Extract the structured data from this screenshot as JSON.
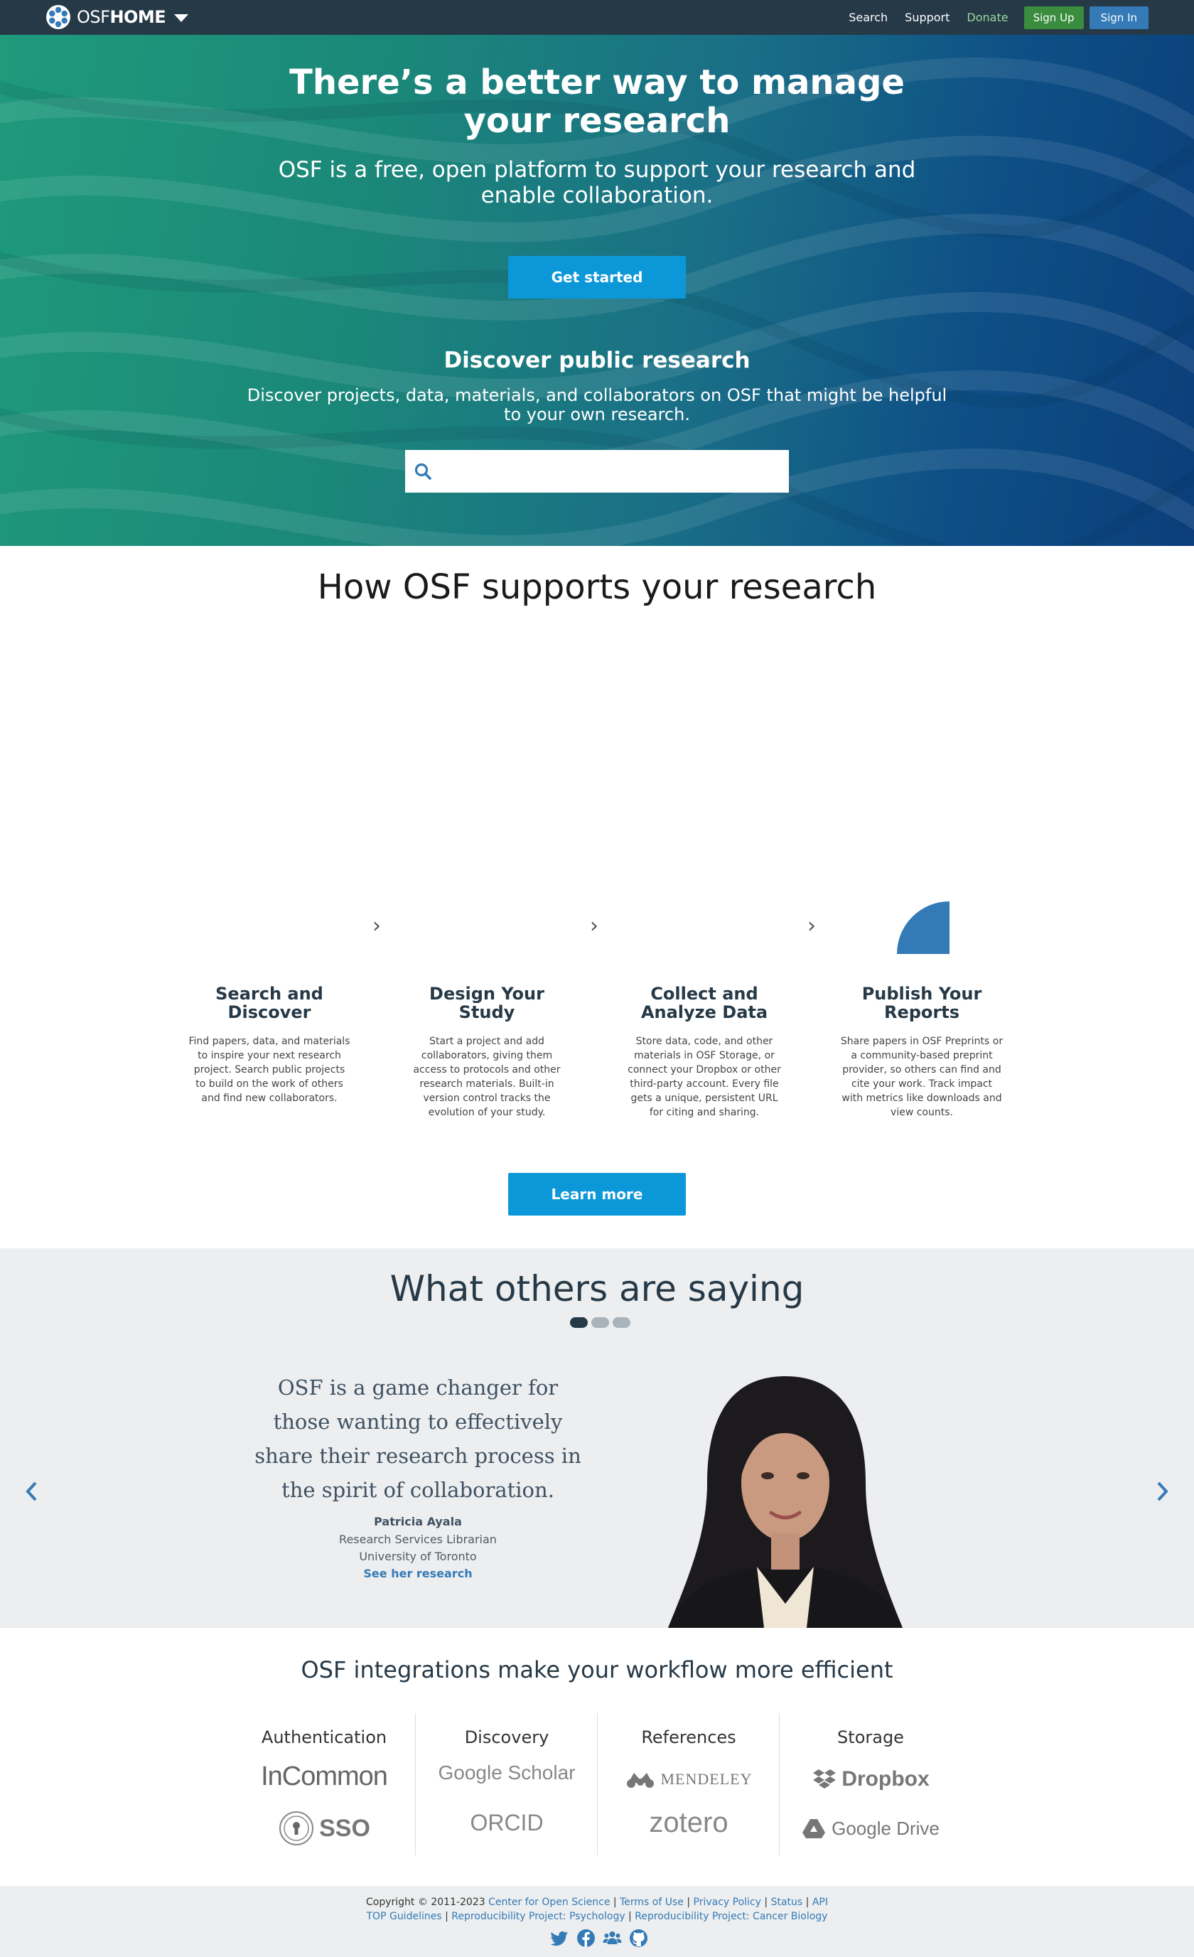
{
  "nav": {
    "brand_prefix": "OSF",
    "brand_suffix": "HOME",
    "links": [
      "Search",
      "Support",
      "Donate"
    ],
    "signup": "Sign Up",
    "signin": "Sign In"
  },
  "hero": {
    "title": "There’s a better way to manage your research",
    "subtitle": "OSF is a free, open platform to support your research and enable collaboration.",
    "cta": "Get started",
    "discover_title": "Discover public research",
    "discover_subtitle": "Discover projects, data, materials, and collaborators on OSF that might be helpful to your own research.",
    "search_placeholder": ""
  },
  "how": {
    "title": "How OSF supports your research",
    "steps": [
      {
        "title": "Search and Discover",
        "desc": "Find papers, data, and materials to inspire your next research project. Search public projects to build on the work of others and find new collaborators."
      },
      {
        "title": "Design Your Study",
        "desc": "Start a project and add collaborators, giving them access to protocols and other research materials. Built-in version control tracks the evolution of your study."
      },
      {
        "title": "Collect and Analyze Data",
        "desc": "Store data, code, and other materials in OSF Storage, or connect your Dropbox or other third-party account. Every file gets a unique, persistent URL for citing and sharing."
      },
      {
        "title": "Publish Your Reports",
        "desc": "Share papers in OSF Preprints or a community-based preprint provider, so others can find and cite your work. Track impact with metrics like downloads and view counts."
      }
    ],
    "cta": "Learn more"
  },
  "testimonials": {
    "title": "What others are saying",
    "quote": "OSF is a game changer for those wanting to effectively share their research process in the spirit of collaboration.",
    "name": "Patricia Ayala",
    "role": "Research Services Librarian",
    "org": "University of Toronto",
    "link": "See her research"
  },
  "integrations": {
    "title": "OSF integrations make your workflow more efficient",
    "columns": [
      {
        "title": "Authentication",
        "logos": [
          "InCommon",
          "SSO"
        ]
      },
      {
        "title": "Discovery",
        "logos": [
          "Google Scholar",
          "ORCID"
        ]
      },
      {
        "title": "References",
        "logos": [
          "MENDELEY",
          "zotero"
        ]
      },
      {
        "title": "Storage",
        "logos": [
          "Dropbox",
          "Google Drive"
        ]
      }
    ]
  },
  "footer": {
    "copyright": "Copyright © 2011-2023",
    "links1": [
      "Center for Open Science",
      "Terms of Use",
      "Privacy Policy",
      "Status",
      "API"
    ],
    "links2": [
      "TOP Guidelines",
      "Reproducibility Project: Psychology",
      "Reproducibility Project: Cancer Biology"
    ],
    "social_icons": [
      "twitter-icon",
      "facebook-icon",
      "group-icon",
      "github-icon"
    ]
  },
  "colors": {
    "navbar": "#263947",
    "primary_button": "#0c98d8",
    "signup": "#3a8c3e",
    "signin": "#337ab7",
    "hero_start": "#1f9a7b",
    "hero_end": "#0b3e7a"
  }
}
